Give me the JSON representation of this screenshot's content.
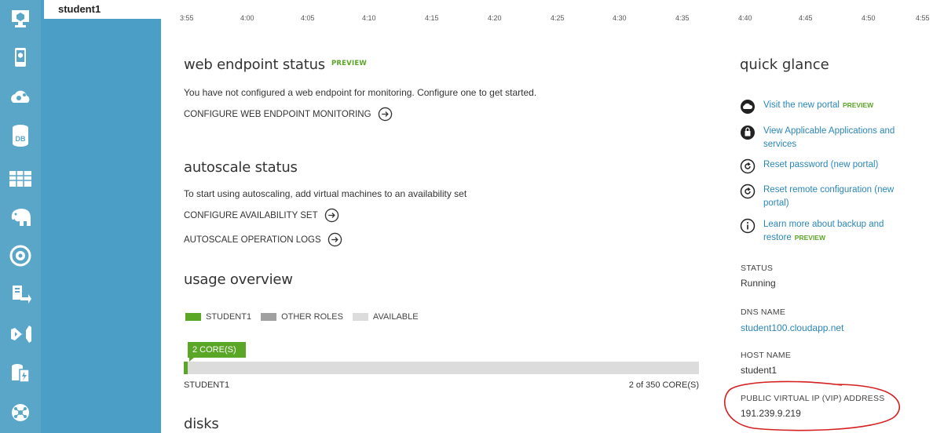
{
  "navigation": {
    "selected_item": "student1",
    "rail_icons": [
      "cloud-service-icon",
      "mobile-service-icon",
      "cloud-gears-icon",
      "database-icon",
      "table-storage-icon",
      "hdinsight-elephant-icon",
      "media-eye-icon",
      "import-export-icon",
      "visual-studio-icon",
      "cache-icon",
      "network-icon"
    ]
  },
  "timeline": {
    "ticks": [
      "3:55",
      "4:00",
      "4:05",
      "4:10",
      "4:15",
      "4:20",
      "4:25",
      "4:30",
      "4:35",
      "4:40",
      "4:45",
      "4:50",
      "4:55"
    ]
  },
  "web_endpoint": {
    "title": "web endpoint status",
    "badge": "PREVIEW",
    "description": "You have not configured a web endpoint for monitoring. Configure one to get started.",
    "action": "CONFIGURE WEB ENDPOINT MONITORING"
  },
  "autoscale": {
    "title": "autoscale status",
    "description": "To start using autoscaling, add virtual machines to an availability set",
    "action_availability": "CONFIGURE AVAILABILITY SET",
    "action_logs": "AUTOSCALE OPERATION LOGS"
  },
  "usage": {
    "title": "usage overview",
    "legend": [
      {
        "label": "STUDENT1",
        "color": "#5aa626"
      },
      {
        "label": "OTHER ROLES",
        "color": "#a0a0a0"
      },
      {
        "label": "AVAILABLE",
        "color": "#dcdcdc"
      }
    ],
    "badge": "2 CORE(S)",
    "row_label": "STUDENT1",
    "summary": "2 of 350 CORE(S)",
    "used_fraction": 0.0057
  },
  "disks": {
    "title": "disks"
  },
  "quick_glance": {
    "title": "quick glance",
    "links": [
      {
        "icon": "cloud-icon",
        "label": "Visit the new portal",
        "badge": "PREVIEW"
      },
      {
        "icon": "lock-bag-icon",
        "label": "View Applicable Applications and services",
        "badge": ""
      },
      {
        "icon": "refresh-icon",
        "label": "Reset password (new portal)",
        "badge": ""
      },
      {
        "icon": "refresh-icon",
        "label": "Reset remote configuration (new portal)",
        "badge": ""
      },
      {
        "icon": "info-icon",
        "label": "Learn more about backup and restore",
        "badge": "PREVIEW"
      }
    ],
    "status_label": "STATUS",
    "status_value": "Running",
    "dns_label": "DNS NAME",
    "dns_value": "student100.cloudapp.net",
    "host_label": "HOST NAME",
    "host_value": "student1",
    "vip_label": "PUBLIC VIRTUAL IP (VIP) ADDRESS",
    "vip_value": "191.239.9.219"
  },
  "colors": {
    "rail": "#5aa6c9",
    "nav": "#4b9fc6",
    "accent_green": "#5aa626",
    "link_blue": "#2a86b8",
    "annotation_red": "#d42020"
  }
}
